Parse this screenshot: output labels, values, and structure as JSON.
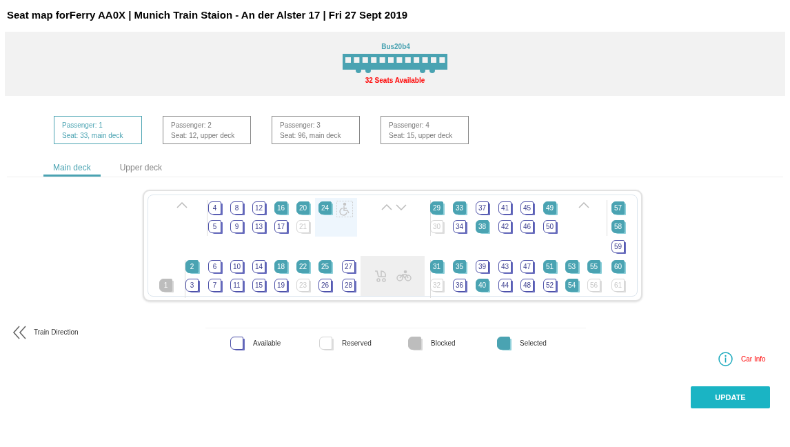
{
  "title": "Seat map forFerry AA0X | Munich Train Staion - An der Alster 17 | Fri 27 Sept 2019",
  "banner": {
    "vehicle_name": "Bus20b4",
    "availability": "32 Seats Available"
  },
  "passengers": [
    {
      "label": "Passenger: 1",
      "seat": "Seat: 33, main deck",
      "selected": true
    },
    {
      "label": "Passenger: 2",
      "seat": "Seat: 12, upper deck",
      "selected": false
    },
    {
      "label": "Passenger: 3",
      "seat": "Seat: 96, main deck",
      "selected": false
    },
    {
      "label": "Passenger: 4",
      "seat": "Seat: 15, upper deck",
      "selected": false
    }
  ],
  "tabs": [
    {
      "label": "Main deck",
      "selected": true
    },
    {
      "label": "Upper deck",
      "selected": false
    }
  ],
  "seat_rows": [
    {
      "seats": [
        {
          "number": "4",
          "kind": "available"
        },
        {
          "number": "8",
          "kind": "available"
        },
        {
          "number": "12",
          "kind": "available"
        },
        {
          "number": "16",
          "kind": "selected"
        },
        {
          "number": "20",
          "kind": "selected"
        },
        {
          "number": "24",
          "kind": "selected"
        },
        {
          "number": "29",
          "kind": "selected"
        },
        {
          "number": "33",
          "kind": "selected"
        },
        {
          "number": "37",
          "kind": "available"
        },
        {
          "number": "41",
          "kind": "available"
        },
        {
          "number": "45",
          "kind": "available"
        },
        {
          "number": "49",
          "kind": "selected"
        },
        {
          "number": "57",
          "kind": "selected"
        }
      ]
    },
    {
      "seats": [
        {
          "number": "5",
          "kind": "available"
        },
        {
          "number": "9",
          "kind": "available"
        },
        {
          "number": "13",
          "kind": "available"
        },
        {
          "number": "17",
          "kind": "available"
        },
        {
          "number": "21",
          "kind": "reserved"
        },
        {
          "number": "30",
          "kind": "reserved"
        },
        {
          "number": "34",
          "kind": "available"
        },
        {
          "number": "38",
          "kind": "selected"
        },
        {
          "number": "42",
          "kind": "available"
        },
        {
          "number": "46",
          "kind": "available"
        },
        {
          "number": "50",
          "kind": "available"
        },
        {
          "number": "58",
          "kind": "selected"
        }
      ]
    },
    {
      "seats": [
        {
          "number": "59",
          "kind": "available"
        }
      ]
    },
    {
      "seats": [
        {
          "number": "2",
          "kind": "selected"
        },
        {
          "number": "6",
          "kind": "available"
        },
        {
          "number": "10",
          "kind": "available"
        },
        {
          "number": "14",
          "kind": "available"
        },
        {
          "number": "18",
          "kind": "selected"
        },
        {
          "number": "22",
          "kind": "selected"
        },
        {
          "number": "25",
          "kind": "selected"
        },
        {
          "number": "27",
          "kind": "available"
        },
        {
          "number": "31",
          "kind": "selected"
        },
        {
          "number": "35",
          "kind": "selected"
        },
        {
          "number": "39",
          "kind": "available"
        },
        {
          "number": "43",
          "kind": "available"
        },
        {
          "number": "47",
          "kind": "available"
        },
        {
          "number": "51",
          "kind": "selected"
        },
        {
          "number": "53",
          "kind": "selected"
        },
        {
          "number": "55",
          "kind": "selected"
        },
        {
          "number": "60",
          "kind": "selected"
        }
      ]
    },
    {
      "seats": [
        {
          "number": "1",
          "kind": "blocked"
        },
        {
          "number": "3",
          "kind": "available"
        },
        {
          "number": "7",
          "kind": "available"
        },
        {
          "number": "11",
          "kind": "available"
        },
        {
          "number": "15",
          "kind": "available"
        },
        {
          "number": "19",
          "kind": "available"
        },
        {
          "number": "23",
          "kind": "reserved"
        },
        {
          "number": "26",
          "kind": "available"
        },
        {
          "number": "28",
          "kind": "available"
        },
        {
          "number": "32",
          "kind": "reserved"
        },
        {
          "number": "36",
          "kind": "available"
        },
        {
          "number": "40",
          "kind": "selected"
        },
        {
          "number": "44",
          "kind": "available"
        },
        {
          "number": "48",
          "kind": "available"
        },
        {
          "number": "52",
          "kind": "available"
        },
        {
          "number": "54",
          "kind": "selected"
        },
        {
          "number": "56",
          "kind": "reserved"
        },
        {
          "number": "61",
          "kind": "reserved"
        }
      ]
    }
  ],
  "train_direction": "Train Direction",
  "legend": [
    {
      "label": "Available",
      "kind": "available"
    },
    {
      "label": "Reserved",
      "kind": "reserved"
    },
    {
      "label": "Blocked",
      "kind": "blocked"
    },
    {
      "label": "Selected",
      "kind": "selected"
    }
  ],
  "car_info": "Car Info",
  "update_button": "UPDATE"
}
